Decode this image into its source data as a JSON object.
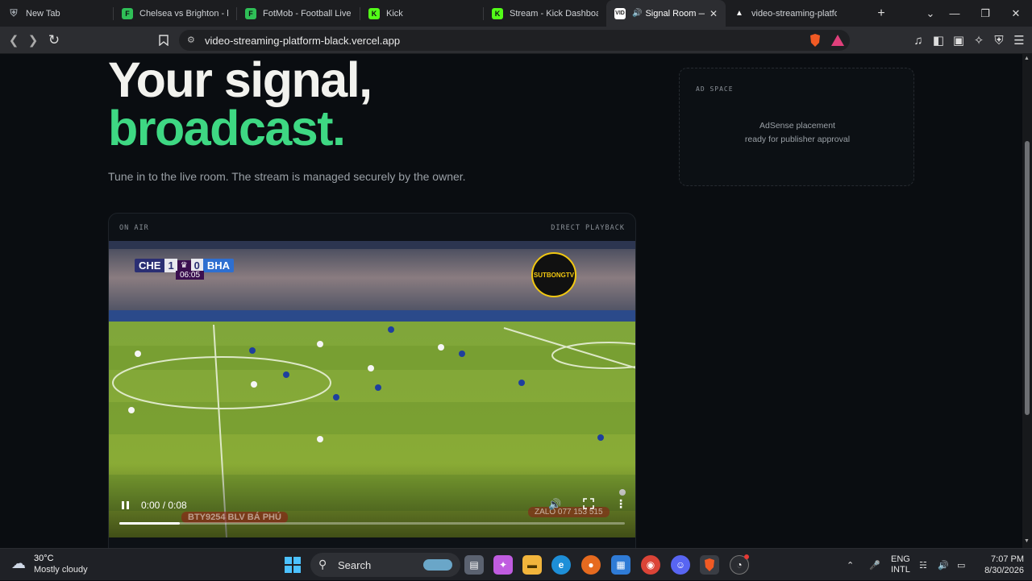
{
  "tabs": [
    {
      "label": "New Tab",
      "favicon": "shield-icon",
      "color": "#9aa0a6"
    },
    {
      "label": "Chelsea vs Brighton - live",
      "favicon": "fotmob-icon",
      "color": "#2fbf57"
    },
    {
      "label": "FotMob - Football Live Sc",
      "favicon": "fotmob-icon",
      "color": "#2fbf57"
    },
    {
      "label": "Kick",
      "favicon": "kick-icon",
      "color": "#53fc18"
    },
    {
      "label": "Stream - Kick Dashboard",
      "favicon": "kick-icon",
      "color": "#53fc18"
    },
    {
      "label": "Signal Room — Li",
      "favicon": "video-icon",
      "color": "#ffffff",
      "active": true
    },
    {
      "label": "video-streaming-platform",
      "favicon": "vercel-icon",
      "color": "#ffffff"
    }
  ],
  "url": "video-streaming-platform-black.vercel.app",
  "hero": {
    "line1": "Your signal,",
    "line2": "broadcast.",
    "accent": "#3ed883",
    "subtitle": "Tune in to the live room. The stream is managed securely by the owner."
  },
  "ad": {
    "label": "AD SPACE",
    "line1": "AdSense placement",
    "line2": "ready for publisher approval"
  },
  "player": {
    "status": "ON AIR",
    "mode": "DIRECT PLAYBACK",
    "time": "0:00 / 0:08",
    "progress": 0.12,
    "overlay": {
      "home": "CHE",
      "away": "BHA",
      "score_home": "1",
      "score_away": "0",
      "clock": "06:05",
      "channel": "SUTBONGTV",
      "bottom_left": "BTY9254  BLV BÁ PHÚ",
      "bottom_right": "ZALO  077 153 515"
    }
  },
  "taskbar": {
    "weather_temp": "30°C",
    "weather_desc": "Mostly cloudy",
    "search": "Search",
    "lang1": "ENG",
    "lang2": "INTL",
    "time": "7:07 PM",
    "date": "8/30/2026"
  }
}
